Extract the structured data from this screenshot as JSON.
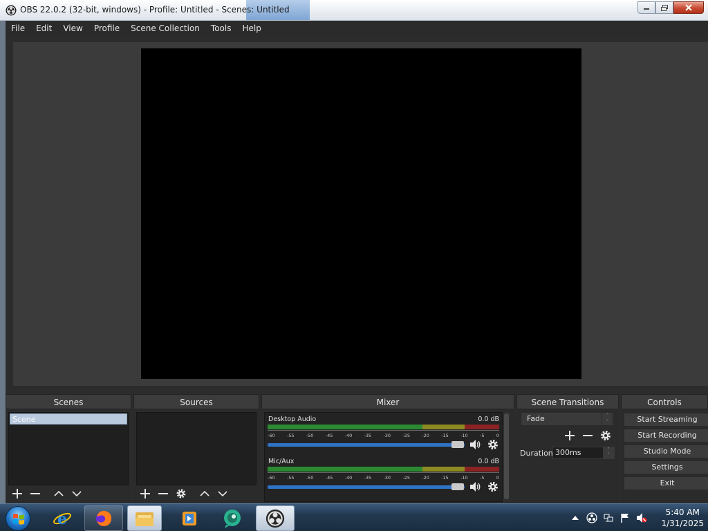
{
  "window": {
    "title": "OBS 22.0.2 (32-bit, windows) - Profile: Untitled - Scenes: Untitled"
  },
  "menu": [
    "File",
    "Edit",
    "View",
    "Profile",
    "Scene Collection",
    "Tools",
    "Help"
  ],
  "docks": {
    "scenes": {
      "title": "Scenes",
      "items": [
        "Scene"
      ],
      "selected": "Scene"
    },
    "sources": {
      "title": "Sources",
      "items": []
    },
    "mixer": {
      "title": "Mixer",
      "channels": [
        {
          "name": "Desktop Audio",
          "level": "0.0 dB",
          "volume_fraction": 1.0
        },
        {
          "name": "Mic/Aux",
          "level": "0.0 dB",
          "volume_fraction": 1.0
        }
      ],
      "tick_labels": [
        "-60",
        "-55",
        "-50",
        "-45",
        "-40",
        "-35",
        "-30",
        "-25",
        "-20",
        "-15",
        "-10",
        "-5",
        "0"
      ]
    },
    "transitions": {
      "title": "Scene Transitions",
      "selected": "Fade",
      "duration_label": "Duration",
      "duration_value": "300ms"
    },
    "controls": {
      "title": "Controls",
      "buttons": [
        "Start Streaming",
        "Start Recording",
        "Studio Mode",
        "Settings",
        "Exit"
      ]
    }
  },
  "taskbar": {
    "apps": [
      "internet-explorer",
      "firefox",
      "file-explorer",
      "media-player",
      "chat-app",
      "obs-studio"
    ],
    "clock": {
      "time": "5:40 AM",
      "date": "1/31/2025"
    }
  }
}
